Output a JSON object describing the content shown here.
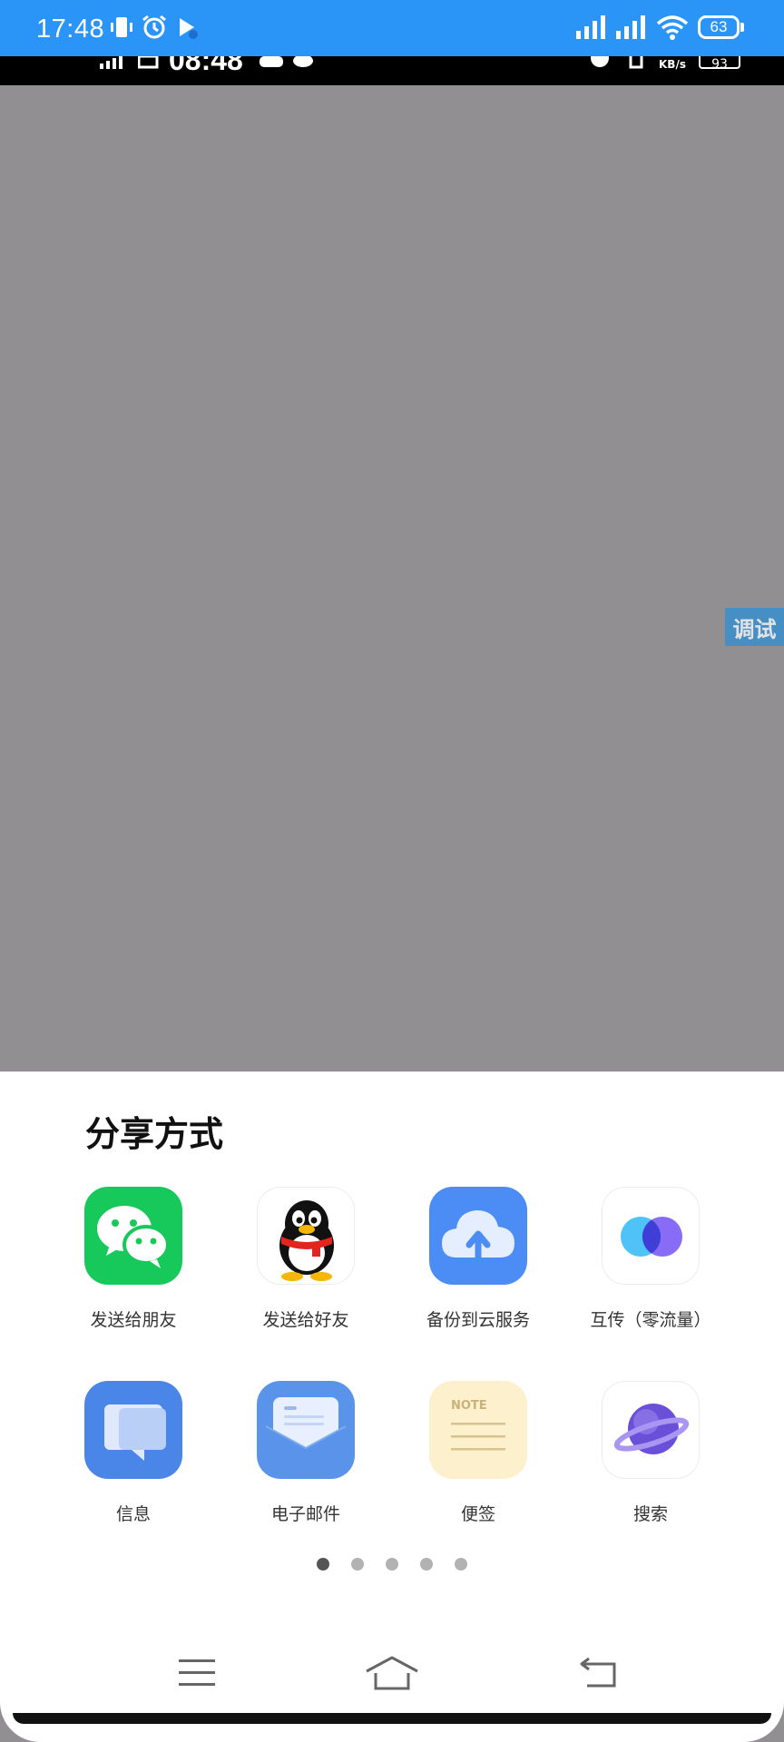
{
  "status_bar": {
    "time": "17:48",
    "battery": "63"
  },
  "captured_status": {
    "time": "08:48",
    "speed_unit": "KB/s",
    "battery": "93"
  },
  "debug_tag": "调试",
  "share_sheet": {
    "title": "分享方式",
    "items": [
      {
        "label": "发送给朋友",
        "icon": "wechat-icon"
      },
      {
        "label": "发送给好友",
        "icon": "qq-icon"
      },
      {
        "label": "备份到云服务",
        "icon": "cloud-backup-icon"
      },
      {
        "label": "互传（零流量）",
        "icon": "transfer-icon"
      },
      {
        "label": "信息",
        "icon": "messages-icon"
      },
      {
        "label": "电子邮件",
        "icon": "email-icon"
      },
      {
        "label": "便签",
        "icon": "notes-icon"
      },
      {
        "label": "搜索",
        "icon": "search-planet-icon"
      }
    ],
    "notes_icon_text": "NOTE",
    "pages": 5,
    "active_page": 1
  },
  "colors": {
    "status_bar": "#2a95f7",
    "backdrop": "#918f92",
    "wechat": "#17c85a",
    "cloud": "#4c8cf5",
    "messages": "#4a86e8",
    "email": "#5a93ea",
    "notes": "#fdf0cc"
  }
}
